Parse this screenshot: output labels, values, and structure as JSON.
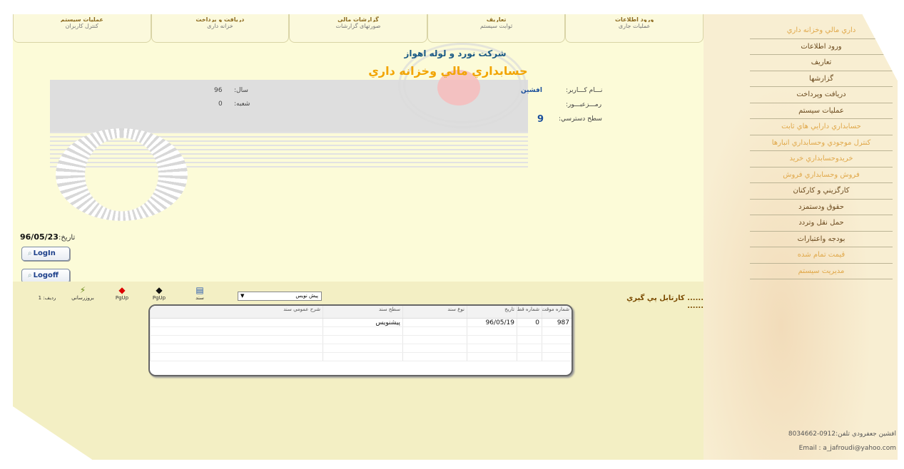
{
  "top_tabs": [
    {
      "title": "عملیات سیستم",
      "subtitle": "کنترل کاربران"
    },
    {
      "title": "دریافت و پرداخت",
      "subtitle": "خزانه داری"
    },
    {
      "title": "گزارشات مالی",
      "subtitle": "صورتهای گزارشات"
    },
    {
      "title": "تعاریف",
      "subtitle": "ثوابت سیستم"
    },
    {
      "title": "ورود اطلاعات",
      "subtitle": "عملیات جاری"
    }
  ],
  "header": {
    "company": "شركت نورد و لوله اهواز",
    "system_title": "حسابداري مالي وخزانه داري"
  },
  "user_info": {
    "username_label": "نـــام كـــاربر:",
    "username_value": "افشين",
    "password_label": "رمـــزعبـــور:",
    "access_label": "سطح دسترسي:",
    "access_value": "9",
    "year_label": "سال:",
    "year_value": "96",
    "branch_label": "شعبه:",
    "branch_value": "0"
  },
  "date": {
    "label": "تاريخ:",
    "value": "96/05/23"
  },
  "buttons": {
    "login": "LogIn",
    "logoff": "Logoff"
  },
  "sidebar": {
    "items": [
      {
        "label": "داري مالي وخزانه داري",
        "style": "light"
      },
      {
        "label": "ورود اطلاعات",
        "style": "dark"
      },
      {
        "label": "تعاريف",
        "style": "dark"
      },
      {
        "label": "گزارشها",
        "style": "dark"
      },
      {
        "label": "دريافت وپرداخت",
        "style": "dark"
      },
      {
        "label": "عمليات سيستم",
        "style": "dark"
      },
      {
        "label": "حسابداري دارايي هاي ثابت",
        "style": "light"
      },
      {
        "label": "كنترل موجودي وحسابداري انبارها",
        "style": "light"
      },
      {
        "label": "خريدوحسابداري خريد",
        "style": "light"
      },
      {
        "label": "فروش وحسابداري فروش",
        "style": "light"
      },
      {
        "label": "كارگزيني و كاركنان",
        "style": "dark"
      },
      {
        "label": "حقوق ودستمزد",
        "style": "dark"
      },
      {
        "label": "حمل نقل وتردد",
        "style": "dark"
      },
      {
        "label": "بودجه واعتبارات",
        "style": "dark"
      },
      {
        "label": "قيمت تمام شده",
        "style": "light"
      },
      {
        "label": "مديريت سيستم",
        "style": "light"
      }
    ],
    "footer_phone": "افشين جعفرودي تلفن:0912-8034662",
    "footer_email": "Email : a_jafroudi@yahoo.com"
  },
  "bottom": {
    "cardex_title": "...... كارتابل پي گيري ......",
    "toolbar": {
      "row_label": "رديف: 1",
      "refresh": "بروزرساني",
      "pgup1": "PgUp",
      "pgup2": "PgUp",
      "doc": "سند",
      "select_value": "پيش نويس"
    },
    "grid": {
      "headers": [
        "شماره موقت",
        "شماره قطعي",
        "تاريخ",
        "نوع سند",
        "سطح سند",
        "شرح عمومي سند"
      ],
      "rows": [
        [
          "987",
          "0",
          "96/05/19",
          "",
          "پيشنويس",
          ""
        ],
        [
          "",
          "",
          "",
          "",
          "",
          ""
        ],
        [
          "",
          "",
          "",
          "",
          "",
          ""
        ],
        [
          "",
          "",
          "",
          "",
          "",
          ""
        ],
        [
          "",
          "",
          "",
          "",
          "",
          ""
        ]
      ]
    }
  },
  "colors": {
    "background": "#fcfbd8",
    "sidebar": "#f8eed2",
    "title_orange": "#f2a400",
    "company_blue": "#1b5a85"
  }
}
